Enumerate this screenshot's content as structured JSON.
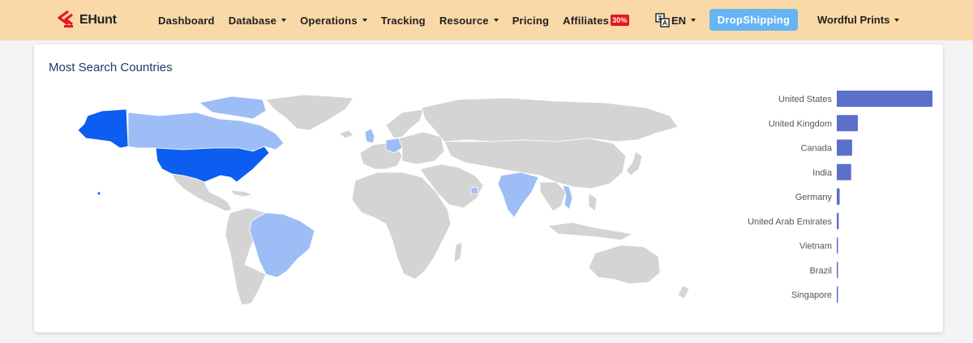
{
  "header": {
    "brand": "EHunt",
    "nav": [
      {
        "label": "Dashboard",
        "dropdown": false
      },
      {
        "label": "Database",
        "dropdown": true
      },
      {
        "label": "Operations",
        "dropdown": true
      },
      {
        "label": "Tracking",
        "dropdown": false
      },
      {
        "label": "Resource",
        "dropdown": true
      },
      {
        "label": "Pricing",
        "dropdown": false
      },
      {
        "label": "Affiliates",
        "dropdown": false
      }
    ],
    "affiliates_badge": "30%",
    "language": "EN",
    "dropshipping_button": "DropShipping",
    "account": "Wordful Prints",
    "colors": {
      "header_bg": "#f9d9a8",
      "button": "#66b4f4",
      "badge": "#e8151c"
    }
  },
  "card": {
    "title": "Most Search Countries"
  },
  "map": {
    "colors": {
      "base": "#d4d4d4",
      "low": "#9dbdf6",
      "high": "#0b5ef0"
    },
    "highlighted": [
      {
        "country": "United States",
        "level": "high"
      },
      {
        "country": "Canada",
        "level": "low"
      },
      {
        "country": "United Kingdom",
        "level": "low"
      },
      {
        "country": "Germany",
        "level": "low"
      },
      {
        "country": "India",
        "level": "low"
      },
      {
        "country": "United Arab Emirates",
        "level": "low"
      },
      {
        "country": "Vietnam",
        "level": "low"
      },
      {
        "country": "Brazil",
        "level": "low"
      }
    ]
  },
  "chart_data": {
    "type": "bar",
    "orientation": "horizontal",
    "categories": [
      "United States",
      "United Kingdom",
      "Canada",
      "India",
      "Germany",
      "United Arab Emirates",
      "Vietnam",
      "Brazil",
      "Singapore"
    ],
    "values": [
      100,
      22,
      16,
      15,
      3,
      2,
      1,
      0.8,
      0.7
    ],
    "xlim": [
      0,
      100
    ],
    "bar_color": "#5b6fcb"
  }
}
